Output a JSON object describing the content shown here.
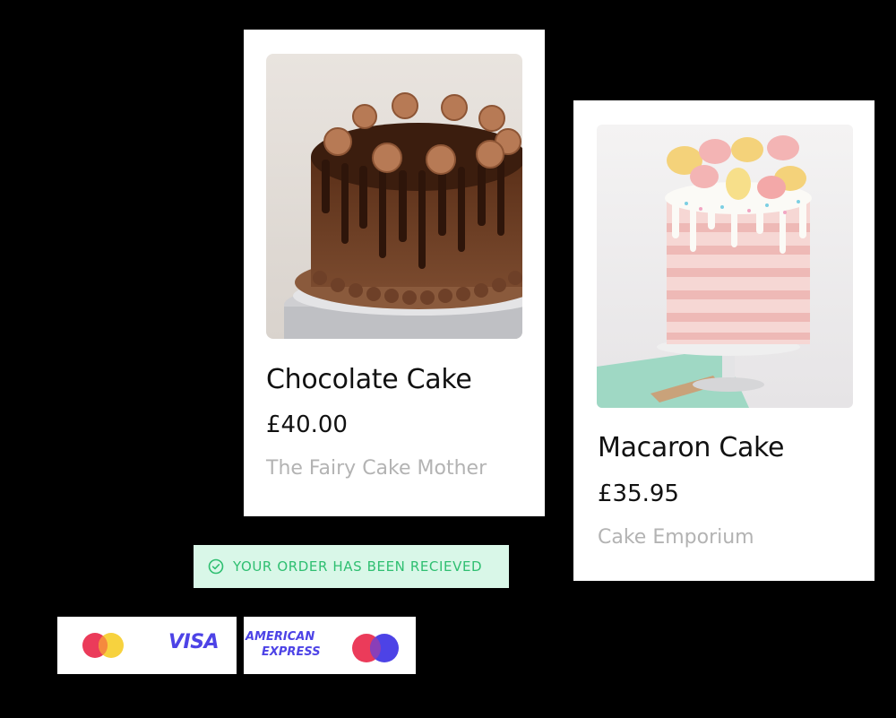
{
  "products": [
    {
      "title": "Chocolate Cake",
      "price": "£40.00",
      "vendor": "The Fairy Cake Mother"
    },
    {
      "title": "Macaron Cake",
      "price": "£35.95",
      "vendor": "Cake Emporium"
    }
  ],
  "order_notice": {
    "icon": "check-circle-icon",
    "text": "YOUR ORDER HAS BEEN RECIEVED",
    "color": "#2fbf71",
    "background": "#d9f7e8"
  },
  "payment_methods": {
    "visa_label": "VISA",
    "amex_line1": "AMERICAN",
    "amex_line2": "EXPRESS",
    "brand_color": "#4d43e6"
  }
}
